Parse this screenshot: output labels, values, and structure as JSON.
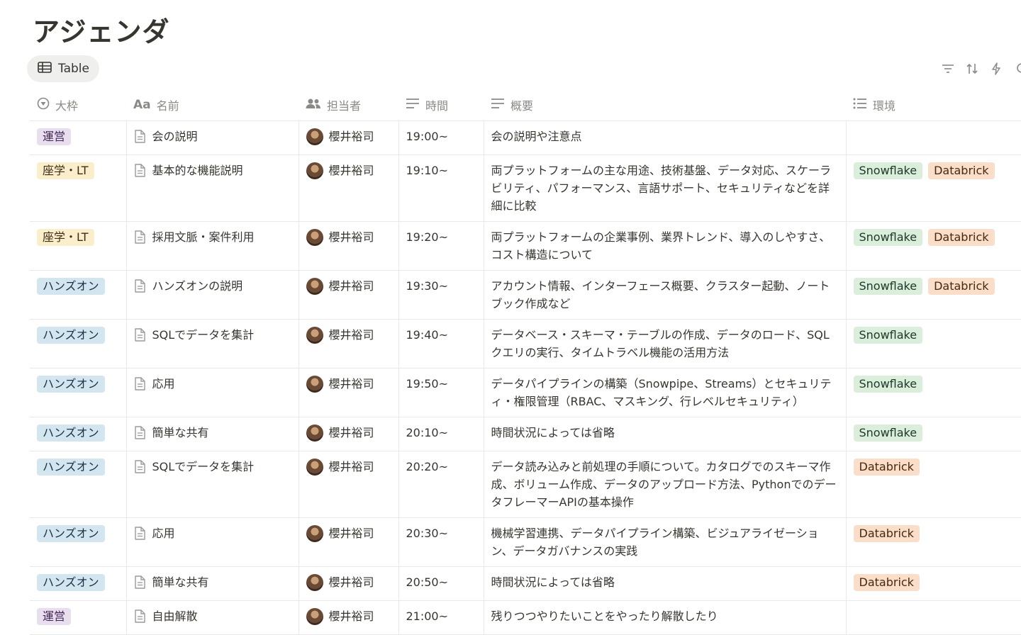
{
  "page": {
    "title": "アジェンダ"
  },
  "view": {
    "tab_label": "Table"
  },
  "columns": {
    "category": "大枠",
    "name": "名前",
    "assignee": "担当者",
    "time": "時間",
    "summary": "概要",
    "env": "環境"
  },
  "rows": [
    {
      "category": "運営",
      "cat_class": "unei",
      "name": "会の説明",
      "assignee": "櫻井裕司",
      "time": "19:00~",
      "summary": "会の説明や注意点",
      "env": []
    },
    {
      "category": "座学・LT",
      "cat_class": "zagaku",
      "name": "基本的な機能説明",
      "assignee": "櫻井裕司",
      "time": "19:10~",
      "summary": "両プラットフォームの主な用途、技術基盤、データ対応、スケーラビリティ、パフォーマンス、言語サポート、セキュリティなどを詳細に比較",
      "env": [
        "Snowflake",
        "Databrick"
      ]
    },
    {
      "category": "座学・LT",
      "cat_class": "zagaku",
      "name": "採用文脈・案件利用",
      "assignee": "櫻井裕司",
      "time": "19:20~",
      "summary": "両プラットフォームの企業事例、業界トレンド、導入のしやすさ、コスト構造について",
      "env": [
        "Snowflake",
        "Databrick"
      ]
    },
    {
      "category": "ハンズオン",
      "cat_class": "hands",
      "name": "ハンズオンの説明",
      "assignee": "櫻井裕司",
      "time": "19:30~",
      "summary": "アカウント情報、インターフェース概要、クラスター起動、ノートブック作成など",
      "env": [
        "Snowflake",
        "Databrick"
      ]
    },
    {
      "category": "ハンズオン",
      "cat_class": "hands",
      "name": "SQLでデータを集計",
      "assignee": "櫻井裕司",
      "time": "19:40~",
      "summary": "データベース・スキーマ・テーブルの作成、データのロード、SQLクエリの実行、タイムトラベル機能の活用方法",
      "env": [
        "Snowflake"
      ]
    },
    {
      "category": "ハンズオン",
      "cat_class": "hands",
      "name": "応用",
      "assignee": "櫻井裕司",
      "time": "19:50~",
      "summary": "データパイプラインの構築（Snowpipe、Streams）とセキュリティ・権限管理（RBAC、マスキング、行レベルセキュリティ）",
      "env": [
        "Snowflake"
      ]
    },
    {
      "category": "ハンズオン",
      "cat_class": "hands",
      "name": "簡単な共有",
      "assignee": "櫻井裕司",
      "time": "20:10~",
      "summary": "時間状況によっては省略",
      "env": [
        "Snowflake"
      ]
    },
    {
      "category": "ハンズオン",
      "cat_class": "hands",
      "name": "SQLでデータを集計",
      "assignee": "櫻井裕司",
      "time": "20:20~",
      "summary": "データ読み込みと前処理の手順について。カタログでのスキーマ作成、ボリューム作成、データのアップロード方法、PythonでのデータフレーマーAPIの基本操作",
      "env": [
        "Databrick"
      ]
    },
    {
      "category": "ハンズオン",
      "cat_class": "hands",
      "name": "応用",
      "assignee": "櫻井裕司",
      "time": "20:30~",
      "summary": "機械学習連携、データパイプライン構築、ビジュアライゼーション、データガバナンスの実践",
      "env": [
        "Databrick"
      ]
    },
    {
      "category": "ハンズオン",
      "cat_class": "hands",
      "name": "簡単な共有",
      "assignee": "櫻井裕司",
      "time": "20:50~",
      "summary": "時間状況によっては省略",
      "env": [
        "Databrick"
      ]
    },
    {
      "category": "運営",
      "cat_class": "unei",
      "name": "自由解散",
      "assignee": "櫻井裕司",
      "time": "21:00~",
      "summary": "残りつつやりたいことをやったり解散したり",
      "env": []
    }
  ],
  "colors": {
    "unei": "#e8deee",
    "zagaku": "#fbeecb",
    "hands": "#d3e5ef",
    "snowflake": "#dbeddb",
    "databrick": "#fadec9"
  }
}
